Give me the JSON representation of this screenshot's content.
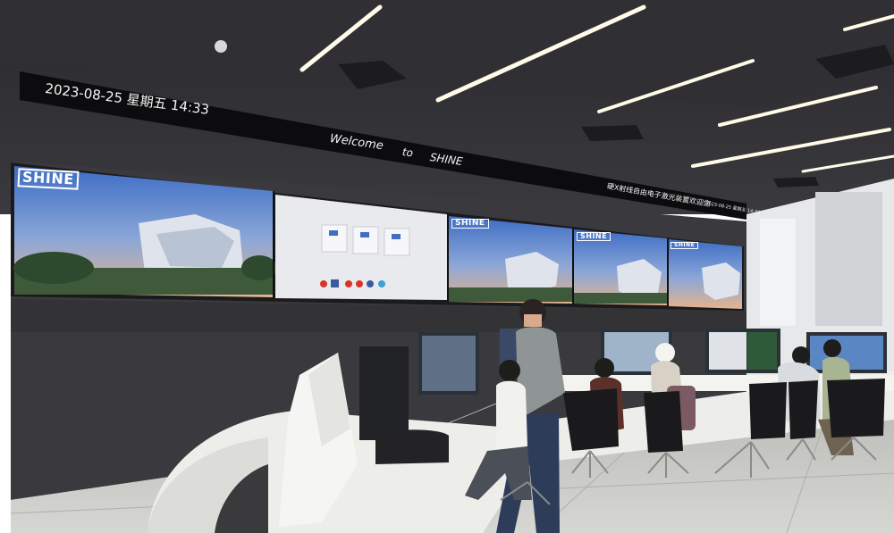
{
  "ticker": {
    "datetime": "2023-08-25 星期五 14:33",
    "welcome": "Welcome",
    "to": "to",
    "facility": "SHINE",
    "right_text": "硬X射线自由电子激光装置欢迎您",
    "right_small": "2023-08-25 星期五 14:33"
  },
  "video_wall": {
    "logo_text": "SHINE"
  },
  "colors": {
    "ceiling": "#2c2c30",
    "wall": "#3b3b3f",
    "floor": "#c9c9c5",
    "desk": "#ededea",
    "sky_top": "#3f6fc2",
    "sky_bottom": "#e7b18c",
    "ticker_bg": "#0c0c0e"
  }
}
